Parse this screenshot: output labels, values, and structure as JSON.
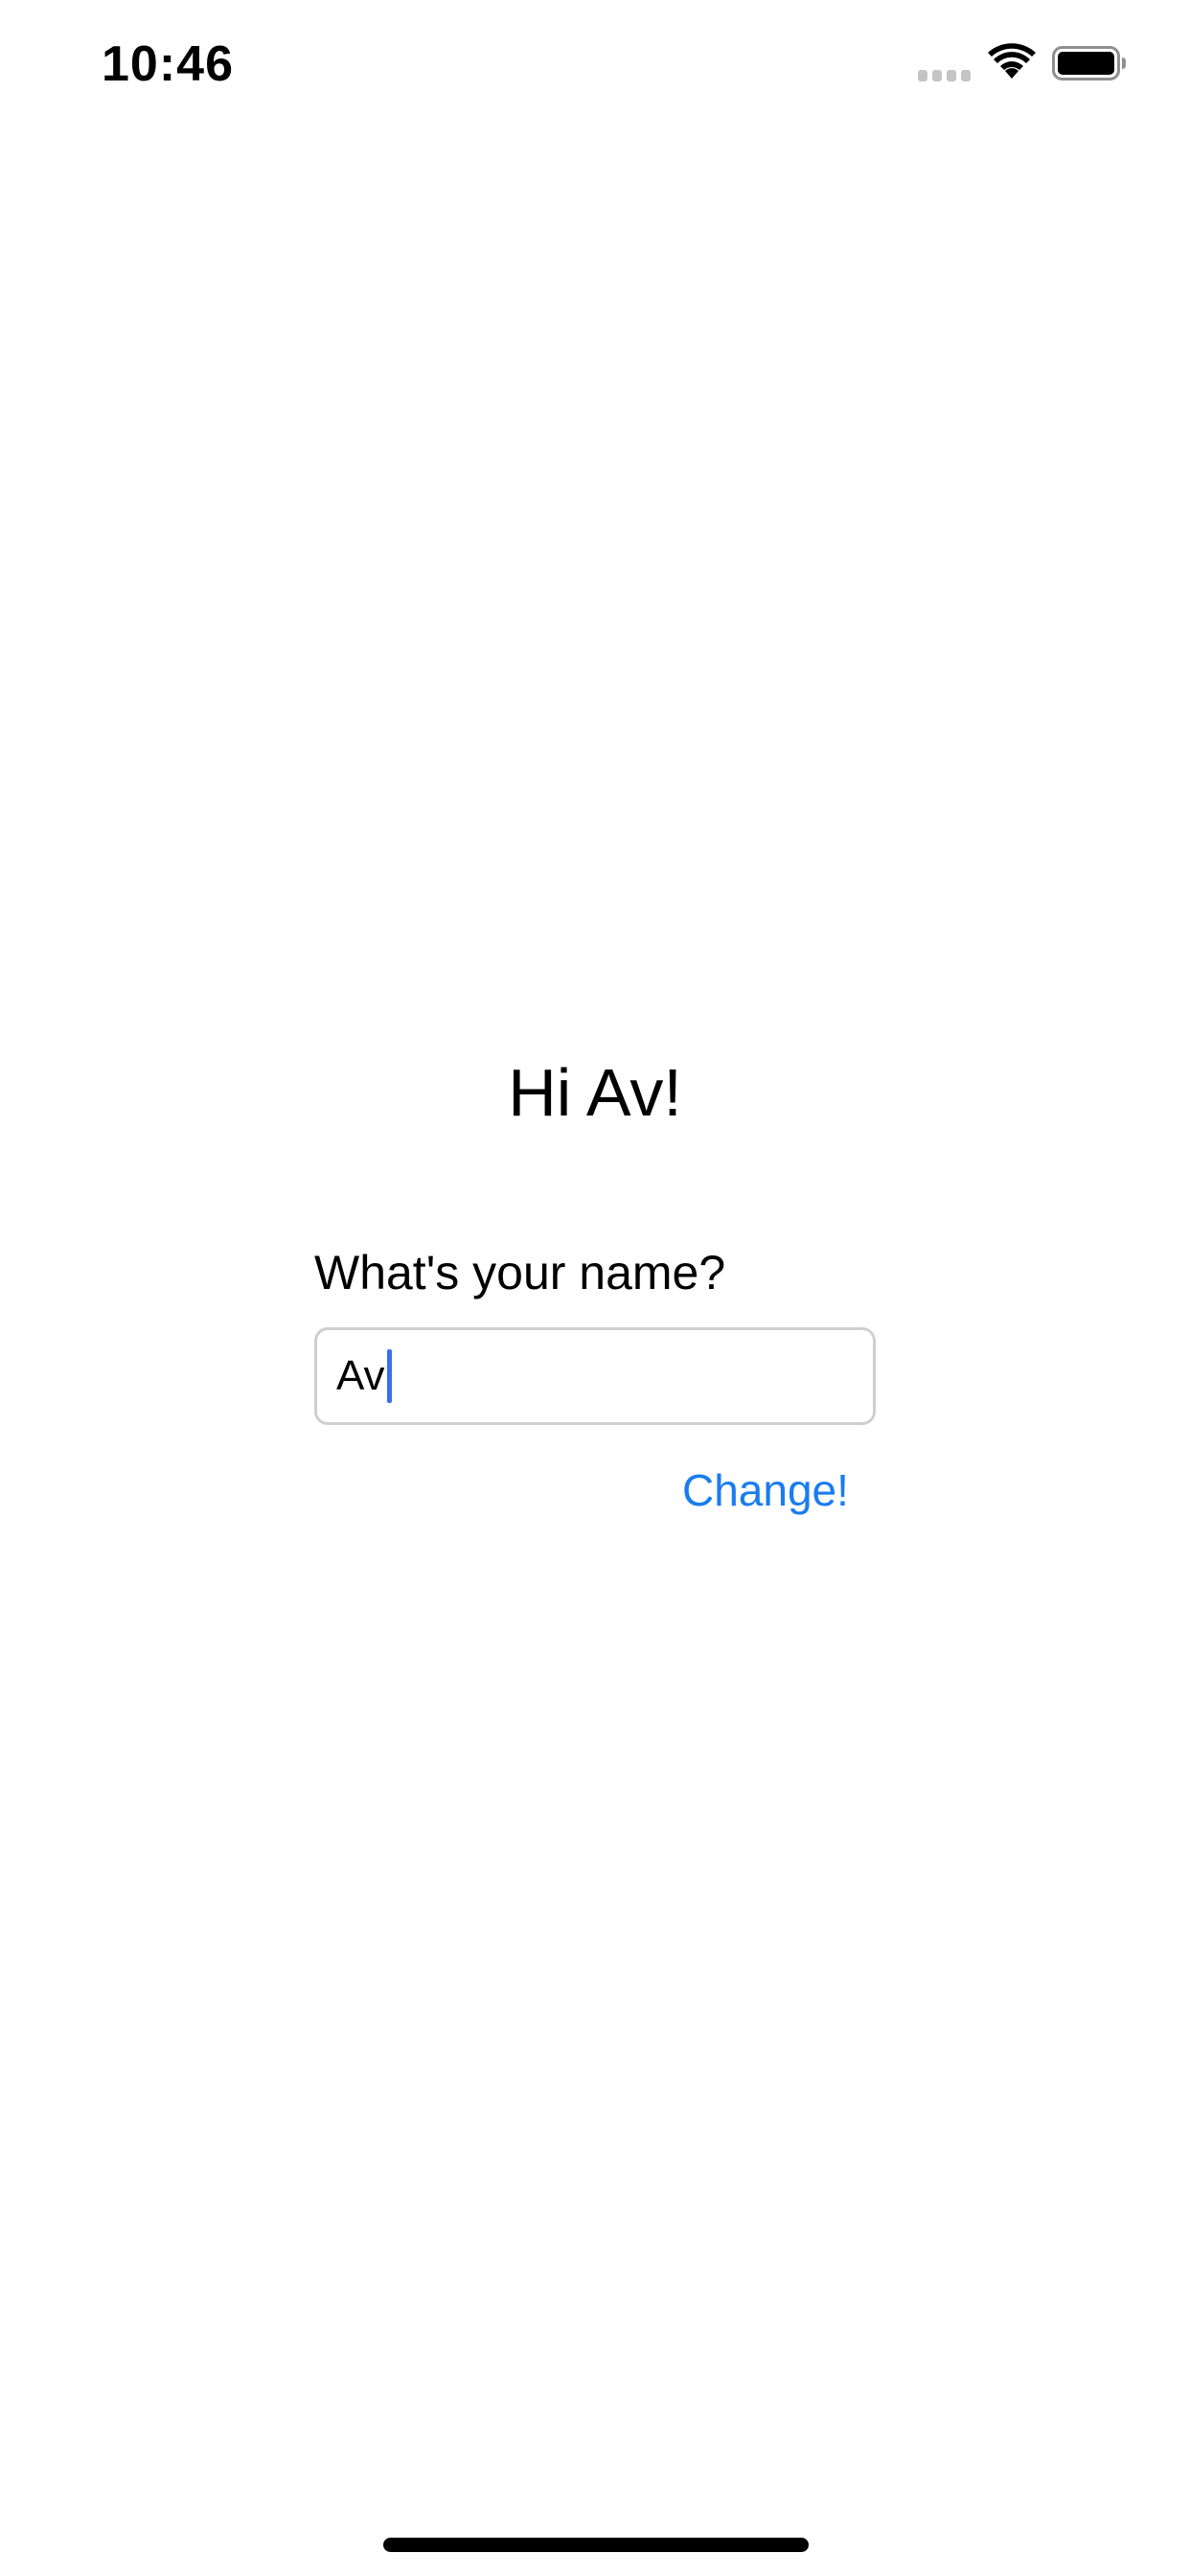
{
  "status_bar": {
    "time": "10:46",
    "icons": [
      "signal-icon",
      "wifi-icon",
      "battery-icon"
    ]
  },
  "main": {
    "greeting": "Hi Av!",
    "name_label": "What's your name?",
    "name_input_value": "Av",
    "change_button_label": "Change!"
  },
  "colors": {
    "accent": "#1a7cf0",
    "caret": "#3a6ff0",
    "input_border": "#cfcfcf",
    "background": "#ffffff"
  }
}
